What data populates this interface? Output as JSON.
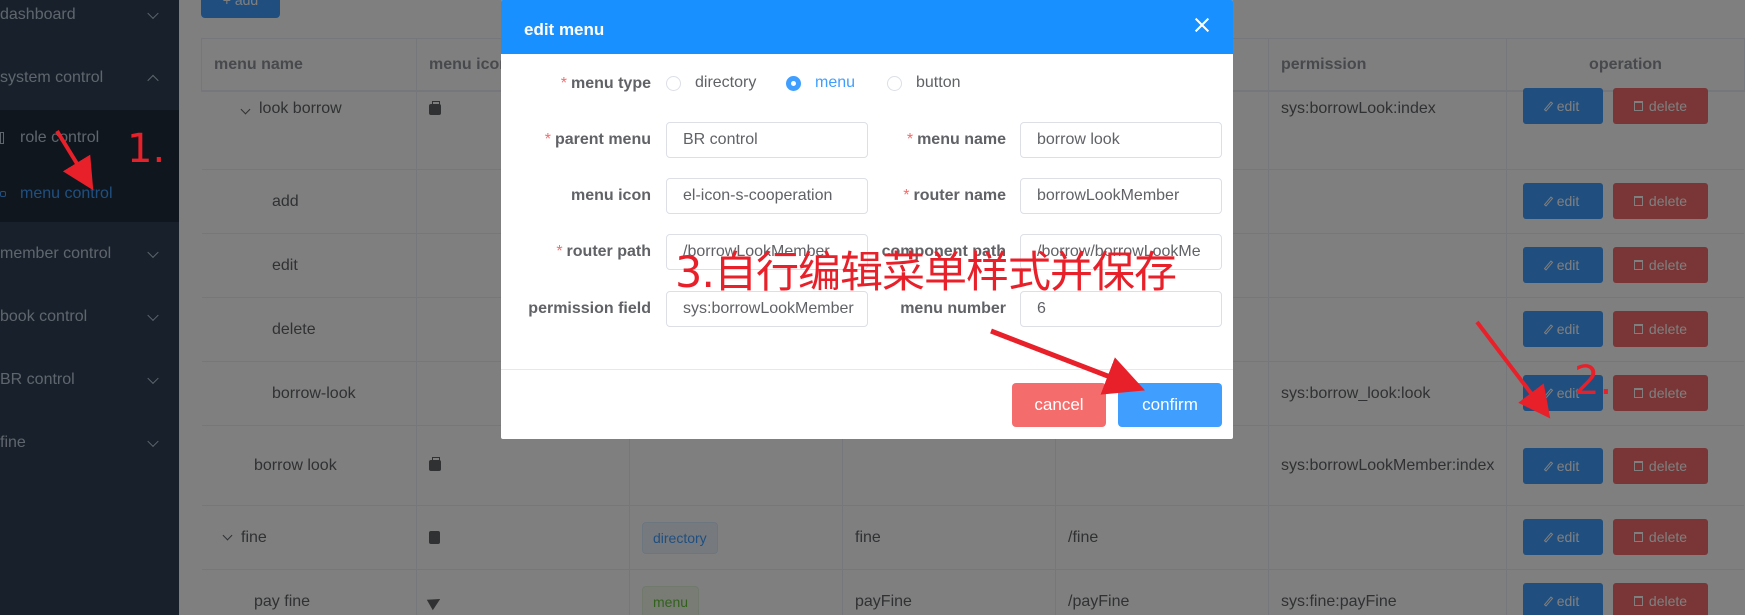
{
  "sidebar": {
    "items": [
      {
        "label": "dashboard",
        "expanded": false
      },
      {
        "label": "system control",
        "expanded": true
      },
      {
        "label": "member control",
        "expanded": false
      },
      {
        "label": "book control",
        "expanded": false
      },
      {
        "label": "BR control",
        "expanded": false
      },
      {
        "label": "fine",
        "expanded": false
      }
    ],
    "sub_items": [
      {
        "label": "role control",
        "active": false
      },
      {
        "label": "menu control",
        "active": true
      }
    ]
  },
  "toolbar": {
    "add_label": "+ add"
  },
  "table": {
    "headers": [
      "menu name",
      "menu icon",
      "",
      "",
      "",
      "permission",
      "operation"
    ],
    "rows": [
      {
        "name": "look borrow",
        "tree_caret": true,
        "icon": "briefcase-icon",
        "type": "",
        "router": "",
        "path": "",
        "permission": "sys:borrowLook:index"
      },
      {
        "name": "add",
        "icon": "",
        "type": "",
        "router": "",
        "path": "",
        "permission": ""
      },
      {
        "name": "edit",
        "icon": "",
        "type": "",
        "router": "",
        "path": "",
        "permission": ""
      },
      {
        "name": "delete",
        "icon": "",
        "type": "",
        "router": "",
        "path": "",
        "permission": ""
      },
      {
        "name": "borrow-look",
        "icon": "",
        "type": "",
        "router": "",
        "path": "",
        "permission": "sys:borrow_look:look"
      },
      {
        "name": "borrow look",
        "icon": "briefcase-icon",
        "type": "",
        "router": "",
        "path": "",
        "permission": "sys:borrowLookMember:index"
      },
      {
        "name": "fine",
        "tree_caret": true,
        "icon": "clipboard-icon",
        "type": "directory",
        "router": "fine",
        "path": "/fine",
        "permission": ""
      },
      {
        "name": "pay fine",
        "icon": "paper-plane-icon",
        "type": "menu",
        "router": "payFine",
        "path": "/payFine",
        "permission": "sys:fine:payFine"
      }
    ],
    "edit_label": "edit",
    "delete_label": "delete"
  },
  "dialog": {
    "title": "edit menu",
    "menu_type_label": "menu type",
    "menu_type_options": [
      "directory",
      "menu",
      "button"
    ],
    "menu_type_selected": "menu",
    "fields": {
      "parent_menu": {
        "label": "parent menu",
        "value": "BR control"
      },
      "menu_name": {
        "label": "menu name",
        "value": "borrow look"
      },
      "menu_icon": {
        "label": "menu icon",
        "value": "el-icon-s-cooperation"
      },
      "router_name": {
        "label": "router name",
        "value": "borrowLookMember"
      },
      "router_path": {
        "label": "router path",
        "value": "/borrowLookMember"
      },
      "component_path": {
        "label": "component path",
        "value": "/borrow/borrowLookMe"
      },
      "permission_field": {
        "label": "permission field",
        "value": "sys:borrowLookMember"
      },
      "menu_number": {
        "label": "menu number",
        "value": "6"
      }
    },
    "cancel_label": "cancel",
    "confirm_label": "confirm"
  },
  "annotations": {
    "step1": "1.",
    "step2": "2.",
    "step3": "3.自行编辑菜单样式并保存"
  },
  "colors": {
    "primary": "#409eff",
    "danger": "#f56c6c",
    "dialog_header": "#1890ff",
    "sidebar": "#304156",
    "annotation": "#e8202a"
  }
}
